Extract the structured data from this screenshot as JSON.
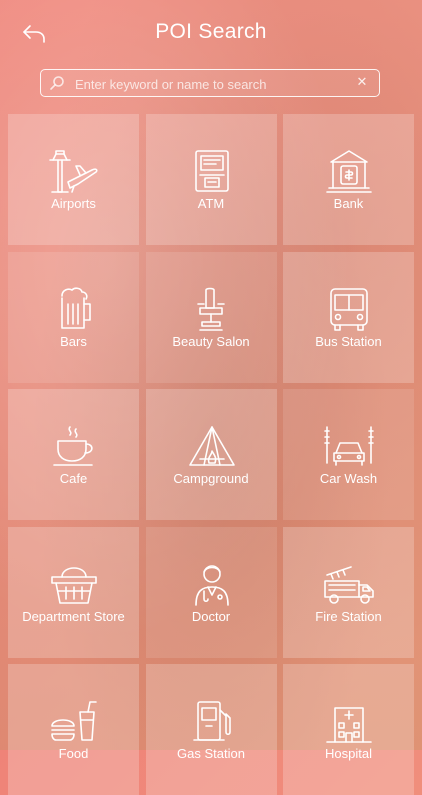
{
  "header": {
    "title": "POI Search",
    "back_icon": "back-arrow-icon"
  },
  "search": {
    "placeholder": "Enter keyword or name to search",
    "value": "",
    "clear_label": "✕"
  },
  "categories": [
    {
      "label": "Airports",
      "icon": "airport-icon"
    },
    {
      "label": "ATM",
      "icon": "atm-icon"
    },
    {
      "label": "Bank",
      "icon": "bank-icon"
    },
    {
      "label": "Bars",
      "icon": "beer-mug-icon"
    },
    {
      "label": "Beauty Salon",
      "icon": "salon-chair-icon"
    },
    {
      "label": "Bus Station",
      "icon": "bus-icon"
    },
    {
      "label": "Cafe",
      "icon": "coffee-cup-icon"
    },
    {
      "label": "Campground",
      "icon": "tent-icon"
    },
    {
      "label": "Car Wash",
      "icon": "car-wash-icon"
    },
    {
      "label": "Department Store",
      "icon": "shopping-basket-icon"
    },
    {
      "label": "Doctor",
      "icon": "doctor-icon"
    },
    {
      "label": "Fire Station",
      "icon": "fire-truck-icon"
    },
    {
      "label": "Food",
      "icon": "burger-drink-icon"
    },
    {
      "label": "Gas Station",
      "icon": "fuel-pump-icon"
    },
    {
      "label": "Hospital",
      "icon": "hospital-building-icon"
    }
  ],
  "colors": {
    "background_start": "#ef8378",
    "background_end": "#f1a27f",
    "foreground": "#ffffff"
  }
}
